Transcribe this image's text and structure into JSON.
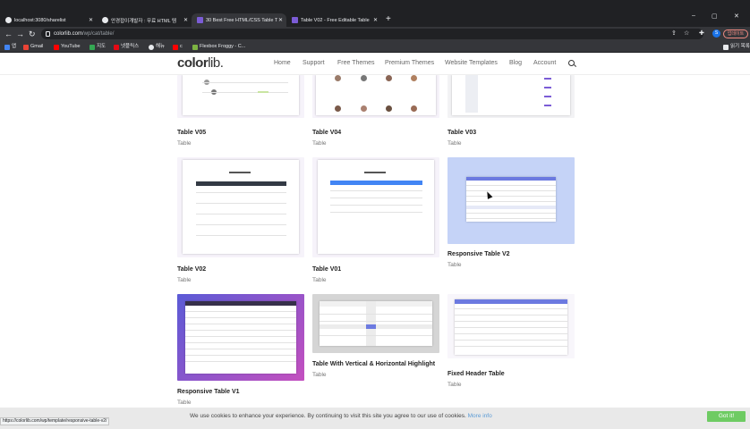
{
  "browser": {
    "tabs": [
      {
        "title": "localhost:3080/sharelist",
        "active": false
      },
      {
        "title": "안경잡이개발자 : 무료 HTML 템",
        "active": false
      },
      {
        "title": "30 Best Free HTML/CSS Table T",
        "active": true
      },
      {
        "title": "Table V02 - Free Editable Table",
        "active": false
      }
    ],
    "new_tab": "+",
    "win_controls": {
      "minimize": "–",
      "maximize": "▢",
      "close": "✕"
    },
    "nav": {
      "back": "←",
      "forward": "→",
      "reload": "↻"
    },
    "url": {
      "host": "colorlib.com",
      "path": "/wp/cat/table/"
    },
    "profile_initial": "S",
    "update_label": "업데이트",
    "bookmarks": [
      {
        "label": "앱",
        "color": "#4285f4"
      },
      {
        "label": "Gmail",
        "color": "#ea4335"
      },
      {
        "label": "YouTube",
        "color": "#ff0000"
      },
      {
        "label": "지도",
        "color": "#34a853"
      },
      {
        "label": "넷플릭스",
        "color": "#e50914"
      },
      {
        "label": "해뉴",
        "color": "#e8eaed"
      },
      {
        "label": "c",
        "color": "#ff0000"
      },
      {
        "label": "Flexbox Froggy - C...",
        "color": "#7cb342"
      }
    ],
    "other_bookmarks": "읽기 목록",
    "status_url": "https://colorlib.com/wp/template/responsive-table-v2/"
  },
  "site": {
    "logo_main": "color",
    "logo_suffix": "lib.",
    "nav": [
      "Home",
      "Support",
      "Free Themes",
      "Premium Themes",
      "Website Templates",
      "Blog",
      "Account"
    ]
  },
  "cards": [
    {
      "title": "Table V05",
      "category": "Table"
    },
    {
      "title": "Table V04",
      "category": "Table"
    },
    {
      "title": "Table V03",
      "category": "Table"
    },
    {
      "title": "Table V02",
      "category": "Table"
    },
    {
      "title": "Table V01",
      "category": "Table"
    },
    {
      "title": "Responsive Table V2",
      "category": "Table"
    },
    {
      "title": "Responsive Table V1",
      "category": "Table"
    },
    {
      "title": "Table With Vertical & Horizontal Highlight",
      "category": "Table"
    },
    {
      "title": "Fixed Header Table",
      "category": "Table"
    }
  ],
  "cookie": {
    "text": "We use cookies to enhance your experience. By continuing to visit this site you agree to our use of cookies.",
    "link": "More info",
    "button": "Got it!"
  },
  "colors": {
    "accent_purple": "#7b5cd6",
    "blue_header": "#4285f4",
    "light_blue_bg": "#c5d3f7",
    "dark_header": "#333a44",
    "gradient_start": "#5b5bd6",
    "gradient_end": "#c44fbf"
  }
}
